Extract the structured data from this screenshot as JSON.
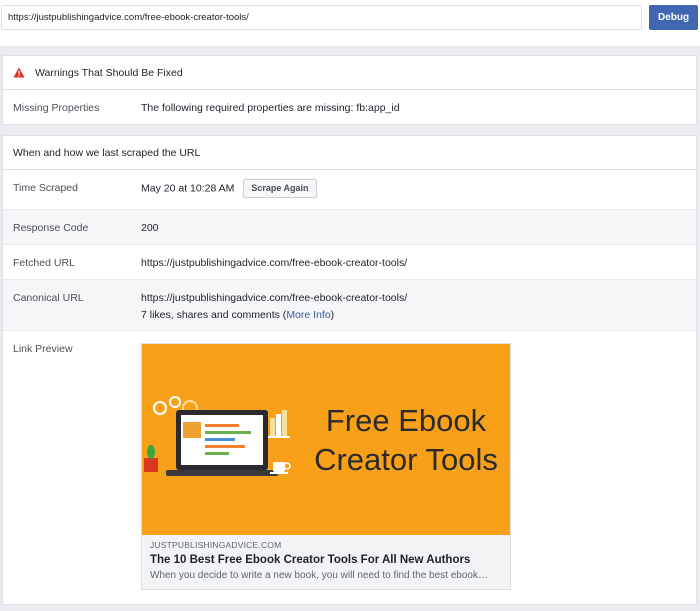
{
  "toolbar": {
    "url_value": "https://justpublishingadvice.com/free-ebook-creator-tools/",
    "debug_label": "Debug"
  },
  "warnings": {
    "title": "Warnings That Should Be Fixed",
    "rows": [
      {
        "label": "Missing Properties",
        "value": "The following required properties are missing: fb:app_id"
      }
    ]
  },
  "scrape": {
    "title": "When and how we last scraped the URL",
    "time_label": "Time Scraped",
    "time_value": "May 20 at 10:28 AM",
    "scrape_again_label": "Scrape Again",
    "response_label": "Response Code",
    "response_value": "200",
    "fetched_label": "Fetched URL",
    "fetched_value": "https://justpublishingadvice.com/free-ebook-creator-tools/",
    "canonical_label": "Canonical URL",
    "canonical_value": "https://justpublishingadvice.com/free-ebook-creator-tools/",
    "engagement_text": "7 likes, shares and comments (",
    "more_info_label": "More Info",
    "engagement_close": ")",
    "preview_label": "Link Preview"
  },
  "preview": {
    "image_text_line1": "Free Ebook",
    "image_text_line2": "Creator Tools",
    "domain": "JUSTPUBLISHINGADVICE.COM",
    "title": "The 10 Best Free Ebook Creator Tools For All New Authors",
    "description": "When you decide to write a new book, you will need to find the best ebook…"
  },
  "colors": {
    "accent": "#4267b2",
    "link": "#365899",
    "warning": "#e0301e",
    "preview_bg": "#f9a01b"
  },
  "icons": {
    "warning": "warning-triangle-icon"
  }
}
